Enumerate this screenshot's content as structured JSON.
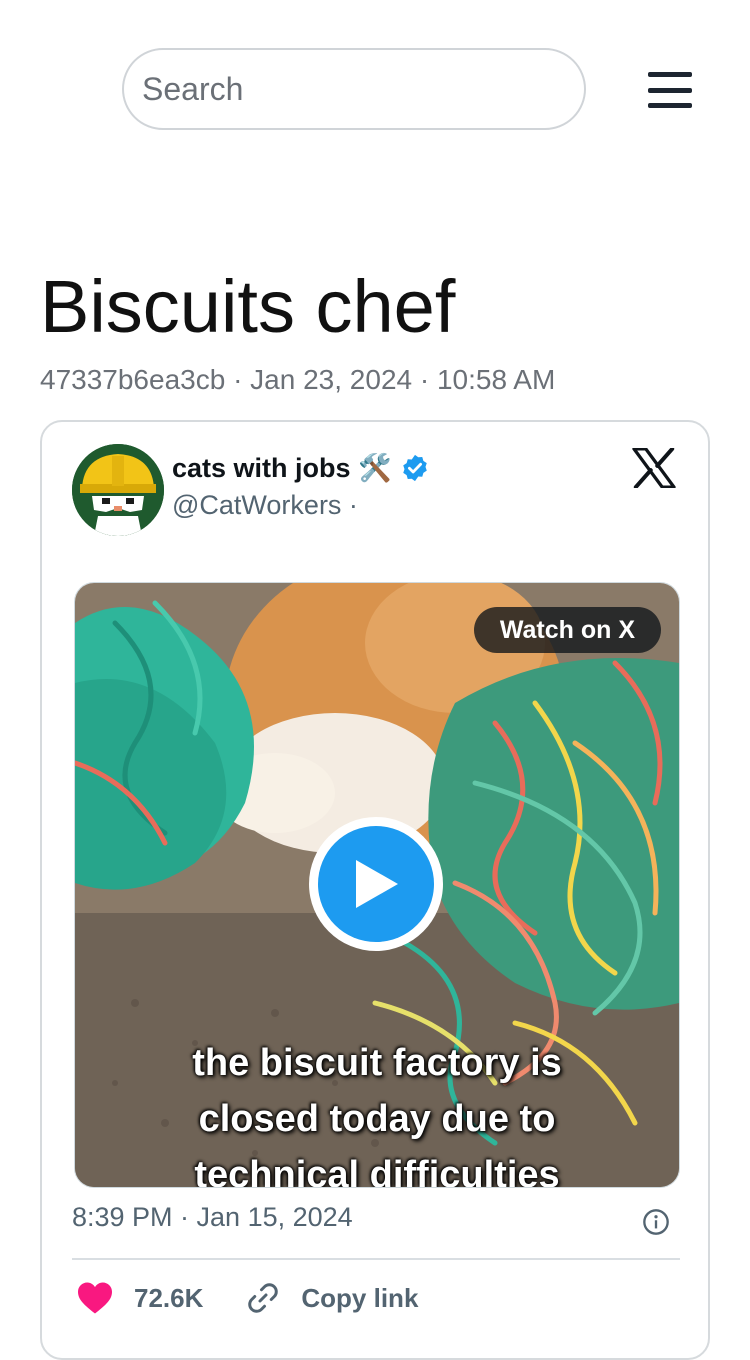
{
  "search": {
    "placeholder": "Search"
  },
  "page": {
    "title": "Biscuits chef",
    "meta": "47337b6ea3cb · Jan 23, 2024 · 10:58 AM"
  },
  "tweet": {
    "author_name": "cats with jobs 🛠️",
    "author_handle": "@CatWorkers ·",
    "watch_label": "Watch on X",
    "caption_lines": [
      "the biscuit factory is",
      "closed today due to",
      "technical difficulties"
    ],
    "timestamp": "8:39 PM · Jan 15, 2024",
    "likes": "72.6K",
    "copy_link": "Copy link"
  },
  "colors": {
    "accent": "#1d9bf0",
    "like": "#f91880",
    "verified": "#1d9bf0"
  },
  "icons": {
    "menu": "hamburger-icon",
    "x": "x-logo-icon",
    "verified": "verified-badge-icon",
    "play": "play-icon",
    "info": "info-icon",
    "heart": "heart-icon",
    "link": "link-icon"
  }
}
